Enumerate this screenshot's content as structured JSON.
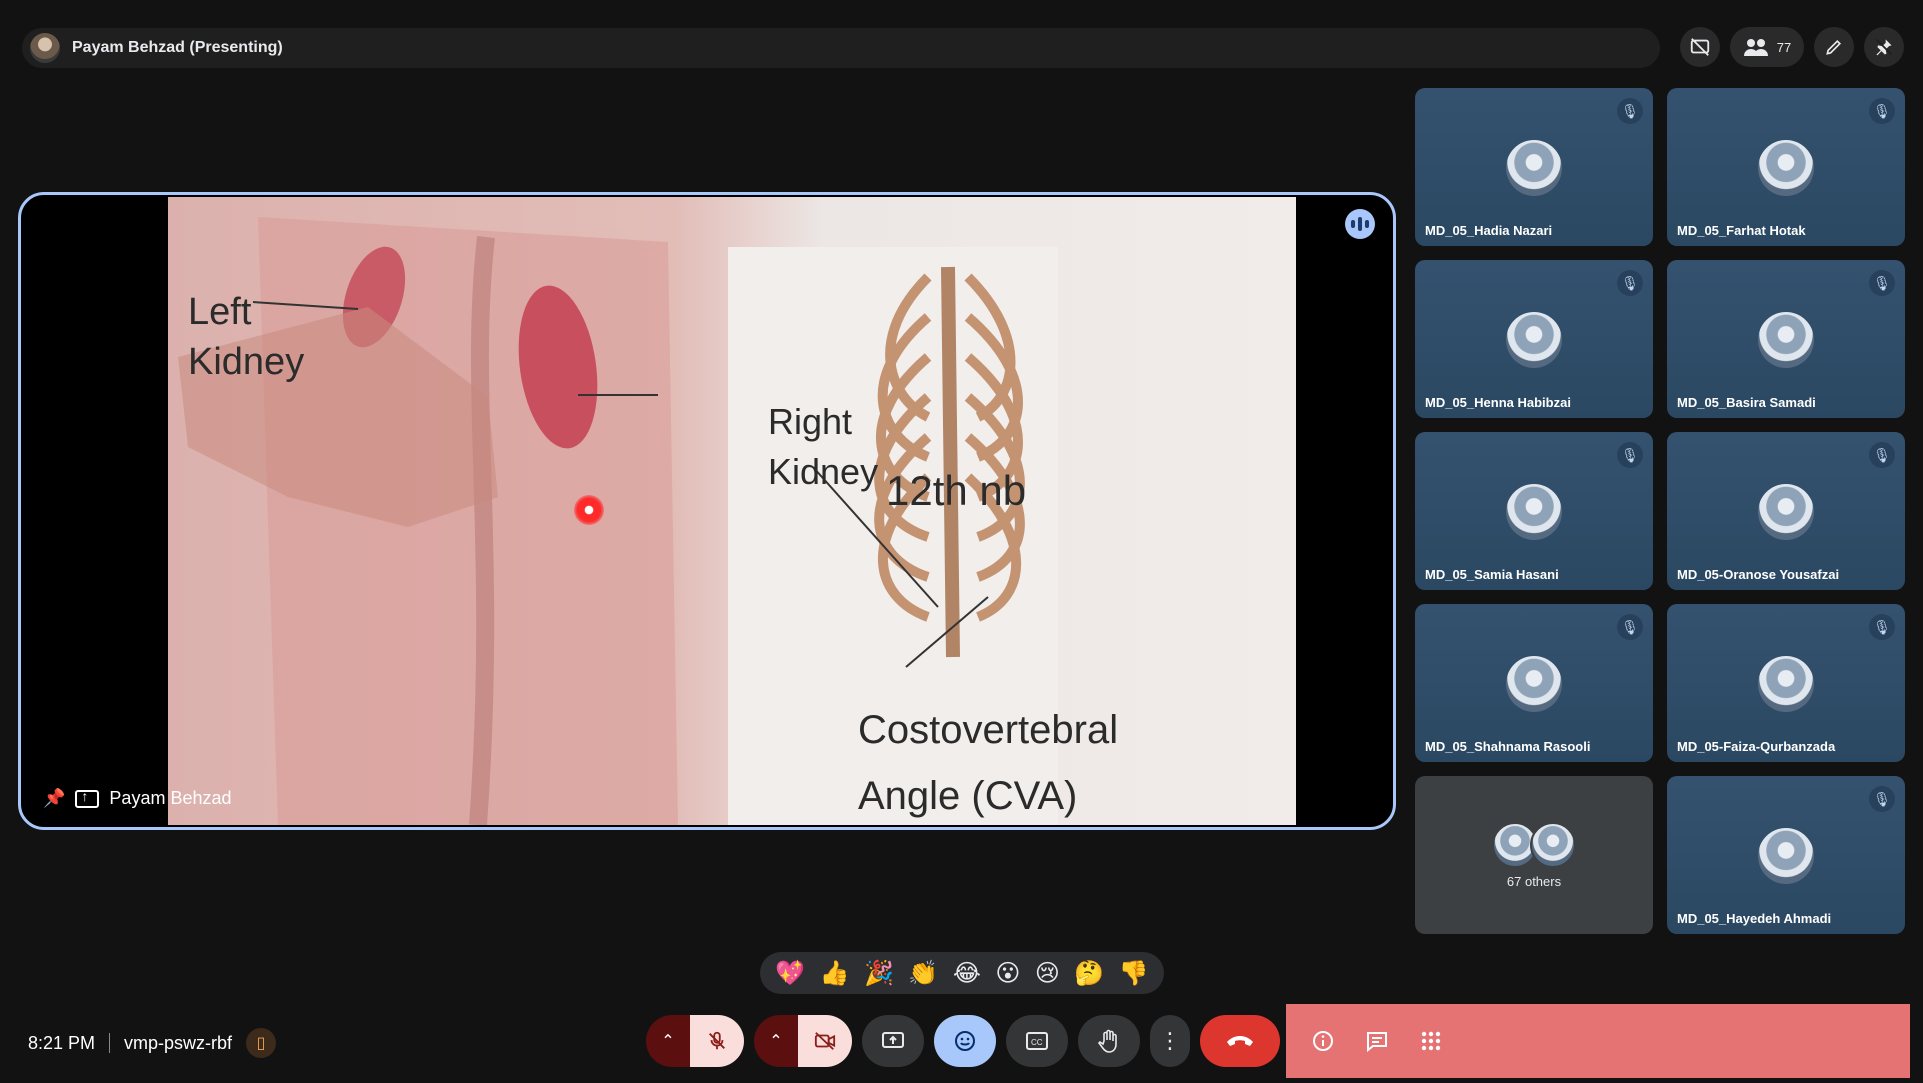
{
  "topbar": {
    "presenter_title": "Payam Behzad (Presenting)",
    "participant_count": "77",
    "icons": [
      "hide-tiles-icon",
      "people-icon",
      "draw-icon",
      "unpin-icon"
    ]
  },
  "stage": {
    "presenter_name": "Payam Behzad",
    "slide_labels": {
      "left_kidney": "Left\nKidney",
      "right_kidney": "Right\nKidney",
      "rib": "12th nb",
      "cva": "Costovertebral\nAngle (CVA)"
    }
  },
  "participants": [
    {
      "name": "MD_05_Hadia Nazari",
      "muted": true
    },
    {
      "name": "MD_05_Farhat Hotak",
      "muted": true
    },
    {
      "name": "MD_05_Henna Habibzai",
      "muted": true
    },
    {
      "name": "MD_05_Basira Samadi",
      "muted": true
    },
    {
      "name": "MD_05_Samia Hasani",
      "muted": true
    },
    {
      "name": "MD_05-Oranose Yousafzai",
      "muted": true
    },
    {
      "name": "MD_05_Shahnama Rasooli",
      "muted": true
    },
    {
      "name": "MD_05-Faiza-Qurbanzada",
      "muted": true
    },
    {
      "others_label": "67 others"
    },
    {
      "name": "MD_05_Hayedeh Ahmadi",
      "muted": true
    }
  ],
  "reactions": [
    "💖",
    "👍",
    "🎉",
    "👏",
    "😂",
    "😮",
    "😢",
    "🤔",
    "👎"
  ],
  "meeting": {
    "time": "8:21 PM",
    "code": "vmp-pswz-rbf"
  },
  "controls": {
    "icons": [
      "mic-off-icon",
      "camera-off-icon",
      "present-screen-icon",
      "emoji-icon",
      "captions-icon",
      "raise-hand-icon",
      "more-options-icon",
      "end-call-icon"
    ]
  },
  "right_bar": {
    "icons": [
      "info-icon",
      "chat-icon",
      "activities-icon"
    ]
  }
}
